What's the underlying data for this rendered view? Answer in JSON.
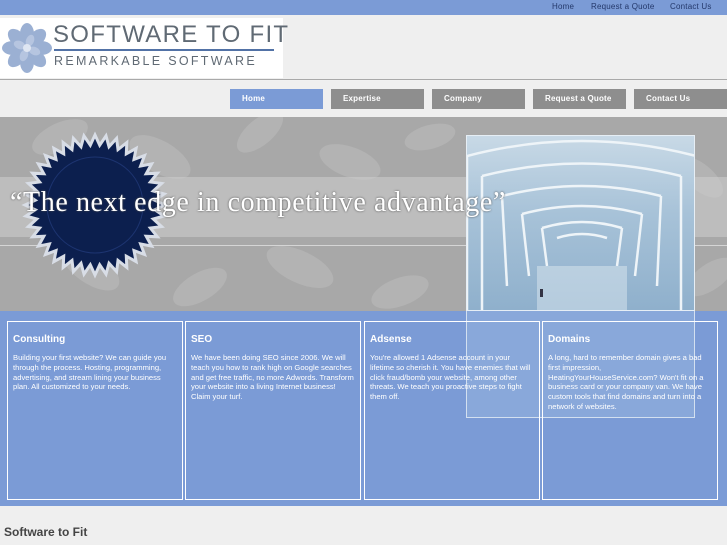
{
  "top_nav": {
    "items": [
      {
        "label": "Home"
      },
      {
        "label": "Request a Quote"
      },
      {
        "label": "Contact Us"
      }
    ]
  },
  "logo": {
    "title": "SOFTWARE TO FIT",
    "subtitle": "REMARKABLE SOFTWARE"
  },
  "main_nav": {
    "items": [
      {
        "label": "Home",
        "active": true
      },
      {
        "label": "Expertise"
      },
      {
        "label": "Company"
      },
      {
        "label": "Request a Quote"
      },
      {
        "label": "Contact Us"
      }
    ]
  },
  "hero": {
    "tagline": "“The next edge in competitive advantage”"
  },
  "services": [
    {
      "title": "Consulting",
      "body": "Building your first website? We can guide you through the process. Hosting, programming, advertising, and stream lining your business plan. All customized to your needs."
    },
    {
      "title": "SEO",
      "body": "We have been doing SEO since 2006. We will teach you how to rank high on Google searches and get free traffic, no more Adwords. Transform your website into a living Internet business! Claim your turf."
    },
    {
      "title": "Adsense",
      "body": "You're allowed 1 Adsense account in your lifetime so cherish it. You have enemies that will click fraud/bomb your website, among other threats. We teach you proactive steps to fight them off."
    },
    {
      "title": "Domains",
      "body": "A long, hard to remember domain gives a bad first impression, HeatingYourHouseService.com? Won't fit on a business card or your company van. We have custom tools that find domains and turn into a network of websites."
    }
  ],
  "footer": {
    "title": "Software to Fit"
  },
  "colors": {
    "accent": "#7b9bd6",
    "nav_gray": "#8e8e8e",
    "seal": "#0c1f4e"
  }
}
